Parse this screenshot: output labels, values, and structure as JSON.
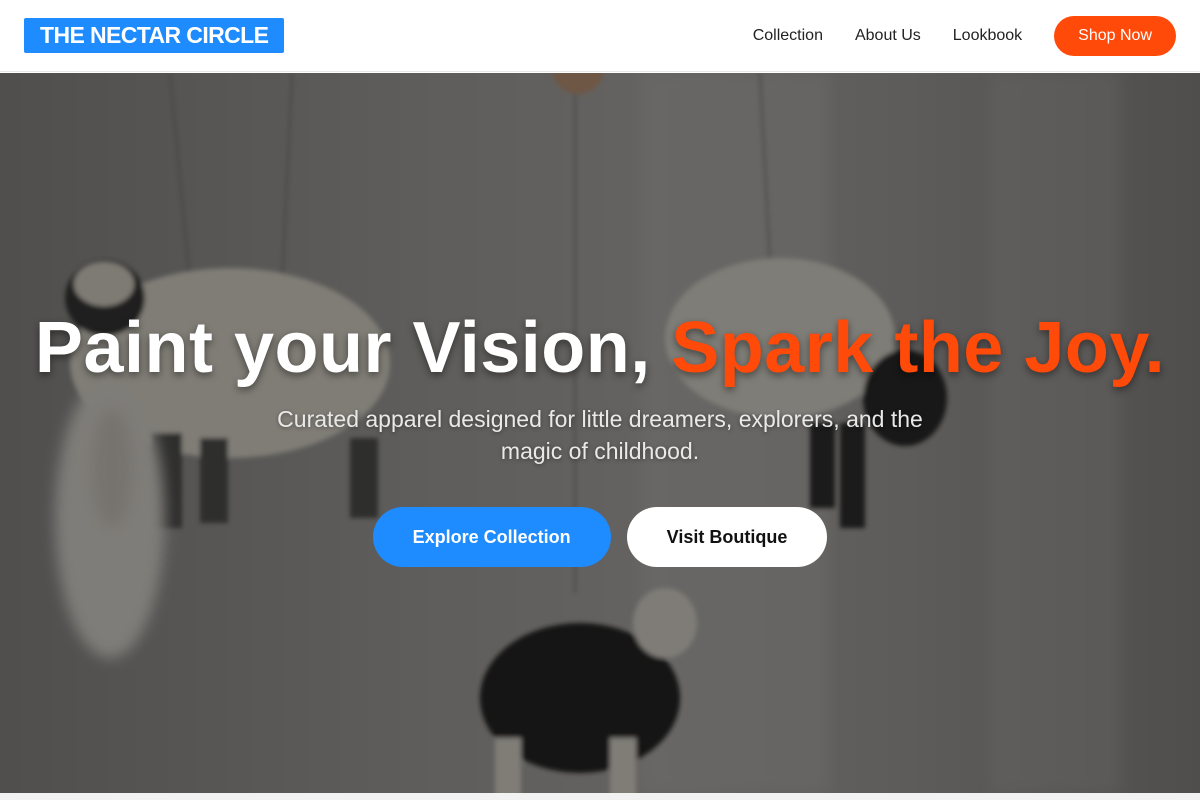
{
  "brand": {
    "name": "THE NECTAR CIRCLE",
    "color": "#1e8bff"
  },
  "nav": {
    "links": [
      "Collection",
      "About Us",
      "Lookbook"
    ],
    "shop_button": "Shop Now",
    "shop_button_color": "#ff4a0a"
  },
  "hero": {
    "headline_main": "Paint your Vision, ",
    "headline_accent": "Spark the Joy.",
    "accent_color": "#ff4a0a",
    "subtitle": "Curated apparel designed for little dreamers, explorers, and the magic of childhood.",
    "primary_cta": "Explore Collection",
    "secondary_cta": "Visit Boutique",
    "background_image": "knitted-sheep-mobile"
  }
}
